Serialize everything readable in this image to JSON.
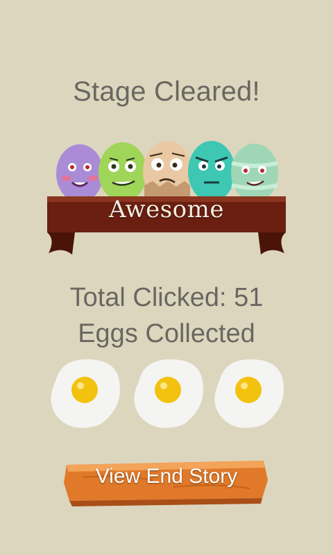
{
  "screen": {
    "title": "Stage Cleared!",
    "rating": "Awesome",
    "total_clicked_label": "Total Clicked: 51",
    "eggs_collected_label": "Eggs Collected",
    "eggs_collected_count": 3,
    "end_button_label": "View End Story"
  },
  "colors": {
    "background": "#ddd6bf",
    "text": "#6a6761",
    "ribbon": "#6b1f10",
    "button_wood": "#e07a2a",
    "yolk": "#f2c20e"
  },
  "eggs": [
    {
      "icon": "purple-egg-icon",
      "color": "#a98bd6"
    },
    {
      "icon": "green-egg-icon",
      "color": "#9fd65a"
    },
    {
      "icon": "tan-egg-icon",
      "color": "#e8c9a3"
    },
    {
      "icon": "teal-egg-icon",
      "color": "#3ec8b4"
    },
    {
      "icon": "mint-egg-icon",
      "color": "#9ed6b6"
    }
  ]
}
